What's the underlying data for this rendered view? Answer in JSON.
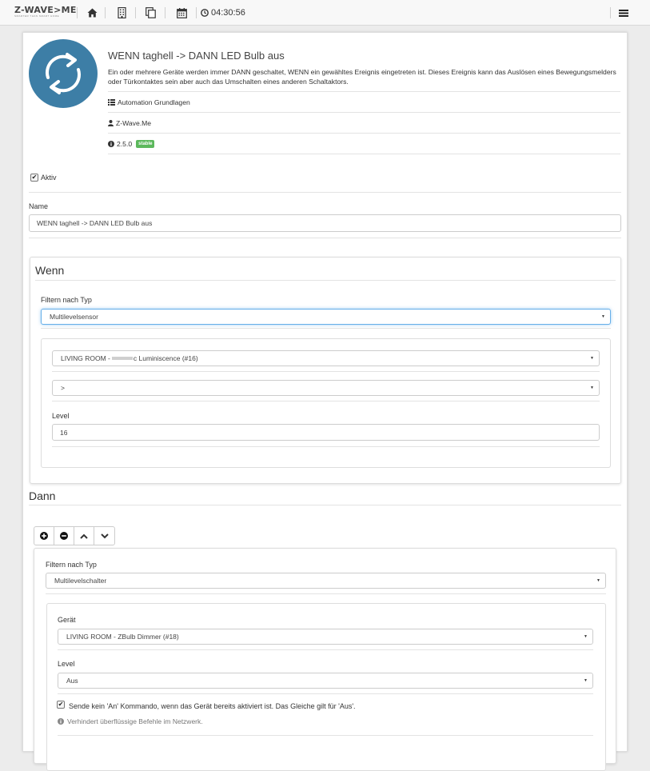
{
  "topbar": {
    "logo": "Z-WAVE>ME",
    "logo_tagline": "SMARTER THAN SMART HOME",
    "time": "04:30:56",
    "icons": [
      "home-icon",
      "building-icon",
      "copy-icon",
      "calendar-icon",
      "clock-icon",
      "menu-icon"
    ]
  },
  "app": {
    "title": "WENN taghell -> DANN LED Bulb aus",
    "description": "Ein oder mehrere Geräte werden immer DANN geschaltet, WENN ein gewähltes Ereignis eingetreten ist. Dieses Ereignis kann das Auslösen eines Bewegungsmelders oder Türkontaktes sein aber auch das Umschalten eines anderen Schaltaktors.",
    "category": "Automation Grundlagen",
    "author": "Z-Wave.Me",
    "version": "2.5.0",
    "status_badge": "stable",
    "icon_color": "#3d7ea6"
  },
  "form": {
    "active_label": "Aktiv",
    "name_label": "Name",
    "name_value": "WENN taghell -> DANN LED Bulb aus"
  },
  "wenn": {
    "title": "Wenn",
    "filter_label": "Filtern nach Typ",
    "filter_value": "Multilevelsensor",
    "device_prefix": "LIVING ROOM -",
    "device_suffix": "c Luminiscence (#16)",
    "operator_value": ">",
    "level_label": "Level",
    "level_value": "16"
  },
  "dann": {
    "title": "Dann",
    "filter_label": "Filtern nach Typ",
    "filter_value": "Multilevelschalter",
    "device_label": "Gerät",
    "device_value": "LIVING ROOM - ZBulb Dimmer (#18)",
    "level_label": "Level",
    "level_value": "Aus",
    "checkbox_label": "Sende kein 'An' Kommando, wenn das Gerät bereits aktiviert ist. Das Gleiche gilt für 'Aus'.",
    "help_text": "Verhindert überflüssige Befehle im Netzwerk."
  }
}
